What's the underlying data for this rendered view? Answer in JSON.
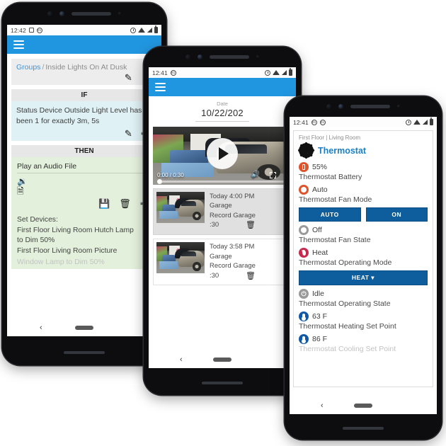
{
  "background": "#ffffff",
  "accent_blue": "#2196e0",
  "button_blue": "#0e5d9c",
  "phone1": {
    "name": "rule-editor-phone",
    "statusbar": {
      "time": "12:42",
      "icons": [
        "image-icon",
        "badge-icon",
        "alarm-icon",
        "wifi-icon",
        "signal-icon",
        "battery-icon"
      ]
    },
    "appbar": {
      "menu_icon": "hamburger-menu-icon"
    },
    "breadcrumb": {
      "root": "Groups",
      "separator": "/",
      "current": "Inside Lights On At Dusk"
    },
    "breadcrumb_actions": {
      "edit_icon": "✎",
      "run_icon": "🏃"
    },
    "if_section": {
      "header": "IF",
      "condition": "Status Device Outside Light Level has been 1 for exactly 3m, 5s",
      "edit_icon": "✎",
      "add_icon": "➕"
    },
    "then_section": {
      "header": "THEN",
      "action_select": "Play an Audio File",
      "caret": "▼",
      "file_icon_1": "audio-file-icon",
      "file_icon_2": "upload-file-icon",
      "save_icon": "💾",
      "delete_icon": "🗑",
      "add_icon": "➕"
    },
    "set_devices": {
      "title": "Set Devices:",
      "lines": [
        "First Floor Living Room Hutch Lamp",
        "to Dim 50%",
        "First Floor Living Room Picture",
        "Window Lamp to Dim 50%"
      ]
    },
    "navbar": {
      "back": "‹",
      "pill": "home-pill"
    }
  },
  "phone2": {
    "name": "video-recordings-phone",
    "statusbar": {
      "time": "12:41"
    },
    "appbar": {
      "menu_icon": "hamburger-menu-icon"
    },
    "date_field": {
      "label": "Date",
      "value": "10/22/202"
    },
    "player": {
      "time_display": "0:00 / 0:30",
      "play_icon": "play-icon",
      "volume_icon": "🔊",
      "fullscreen_icon": "fullscreen-icon",
      "overflow_icon": "more-options-icon"
    },
    "clips": [
      {
        "time": "Today 4:00 PM",
        "camera": "Garage",
        "rule": "Record Garage",
        "duration": ":30",
        "selected": true
      },
      {
        "time": "Today 3:58 PM",
        "camera": "Garage",
        "rule": "Record Garage",
        "duration": ":30",
        "selected": false
      }
    ],
    "navbar": {
      "back": "‹",
      "pill": "home-pill"
    }
  },
  "phone3": {
    "name": "thermostat-phone",
    "statusbar": {
      "time": "12:41"
    },
    "breadcrumb": "First Floor | Living Room",
    "title": "Thermostat",
    "gear_icon": "gear-icon",
    "attributes": [
      {
        "icon": "battery-icon",
        "icon_color": "#e0522a",
        "value": "55%",
        "label": "Thermostat Battery"
      },
      {
        "icon": "fan-icon",
        "icon_color": "#e0522a",
        "value": "Auto",
        "label": "Thermostat Fan Mode"
      },
      {
        "icon": "fan-icon",
        "icon_color": "#9a9a9a",
        "value": "Off",
        "label": "Thermostat Fan State"
      },
      {
        "icon": "flame-icon",
        "icon_color": "#c62a4f",
        "value": "Heat",
        "label": "Thermostat Operating Mode"
      },
      {
        "icon": "power-icon",
        "icon_color": "#9a9a9a",
        "value": "Idle",
        "label": "Thermostat Operating State"
      },
      {
        "icon": "thermometer-icon",
        "icon_color": "#1059a8",
        "value": "63 F",
        "label": "Thermostat Heating Set Point"
      },
      {
        "icon": "thermometer-icon",
        "icon_color": "#1059a8",
        "value": "86 F",
        "label": "Thermostat Cooling Set Point"
      }
    ],
    "fan_buttons": [
      "AUTO",
      "ON"
    ],
    "mode_button": "HEAT ▾",
    "navbar": {
      "back": "‹",
      "pill": "home-pill"
    }
  }
}
